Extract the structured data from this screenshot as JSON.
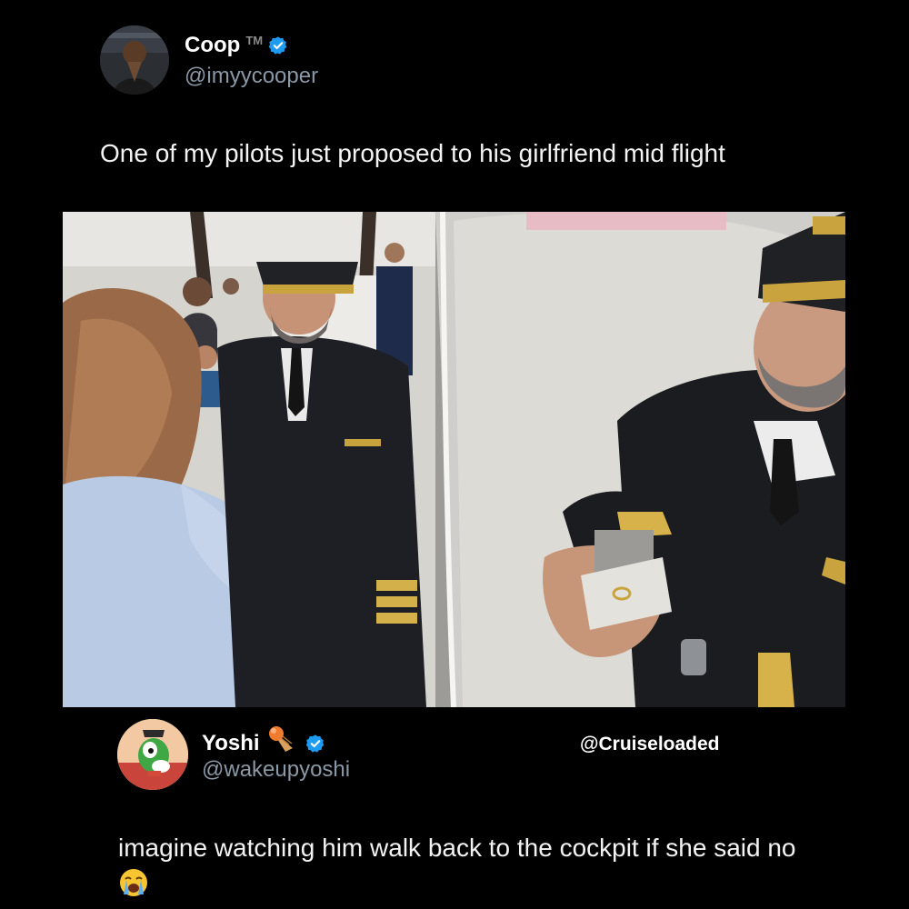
{
  "original_tweet": {
    "display_name": "Coop",
    "tm_mark": "TM",
    "handle": "@imyycooper",
    "text": "One of my pilots just proposed to his girlfriend mid flight",
    "verified": true
  },
  "media": {
    "left_image_icon": "photo-proposal-cabin-icon",
    "right_image_icon": "photo-pilot-ring-icon"
  },
  "reply_tweet": {
    "display_name": "Yoshi",
    "handle": "@wakeupyoshi",
    "name_emoji_icon": "ice-cream-cone-icon",
    "verified": true,
    "text": "imagine watching him walk back to the cockpit if she said no",
    "text_emoji_icon": "loudly-crying-face-icon"
  },
  "watermark": "@Cruiseloaded",
  "colors": {
    "background": "#000000",
    "verified_blue": "#1d9bf0",
    "handle_gray": "#8b98a5",
    "text": "#f3f3f3"
  }
}
